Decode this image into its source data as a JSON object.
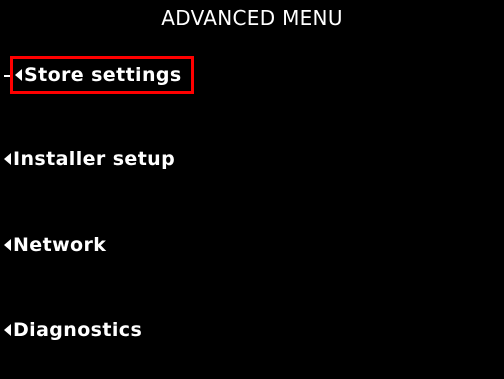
{
  "screen": {
    "title": "ADVANCED MENU",
    "menu_items": [
      {
        "label": "Store settings",
        "icon": "left-arrow-icon",
        "selected": true
      },
      {
        "label": "Installer setup",
        "icon": "left-arrow-icon",
        "selected": false
      },
      {
        "label": "Network",
        "icon": "left-arrow-icon",
        "selected": false
      },
      {
        "label": "Diagnostics",
        "icon": "left-arrow-icon",
        "selected": false
      }
    ]
  },
  "colors": {
    "background": "#000000",
    "text": "#ffffff",
    "selection_highlight": "#ff0000"
  }
}
